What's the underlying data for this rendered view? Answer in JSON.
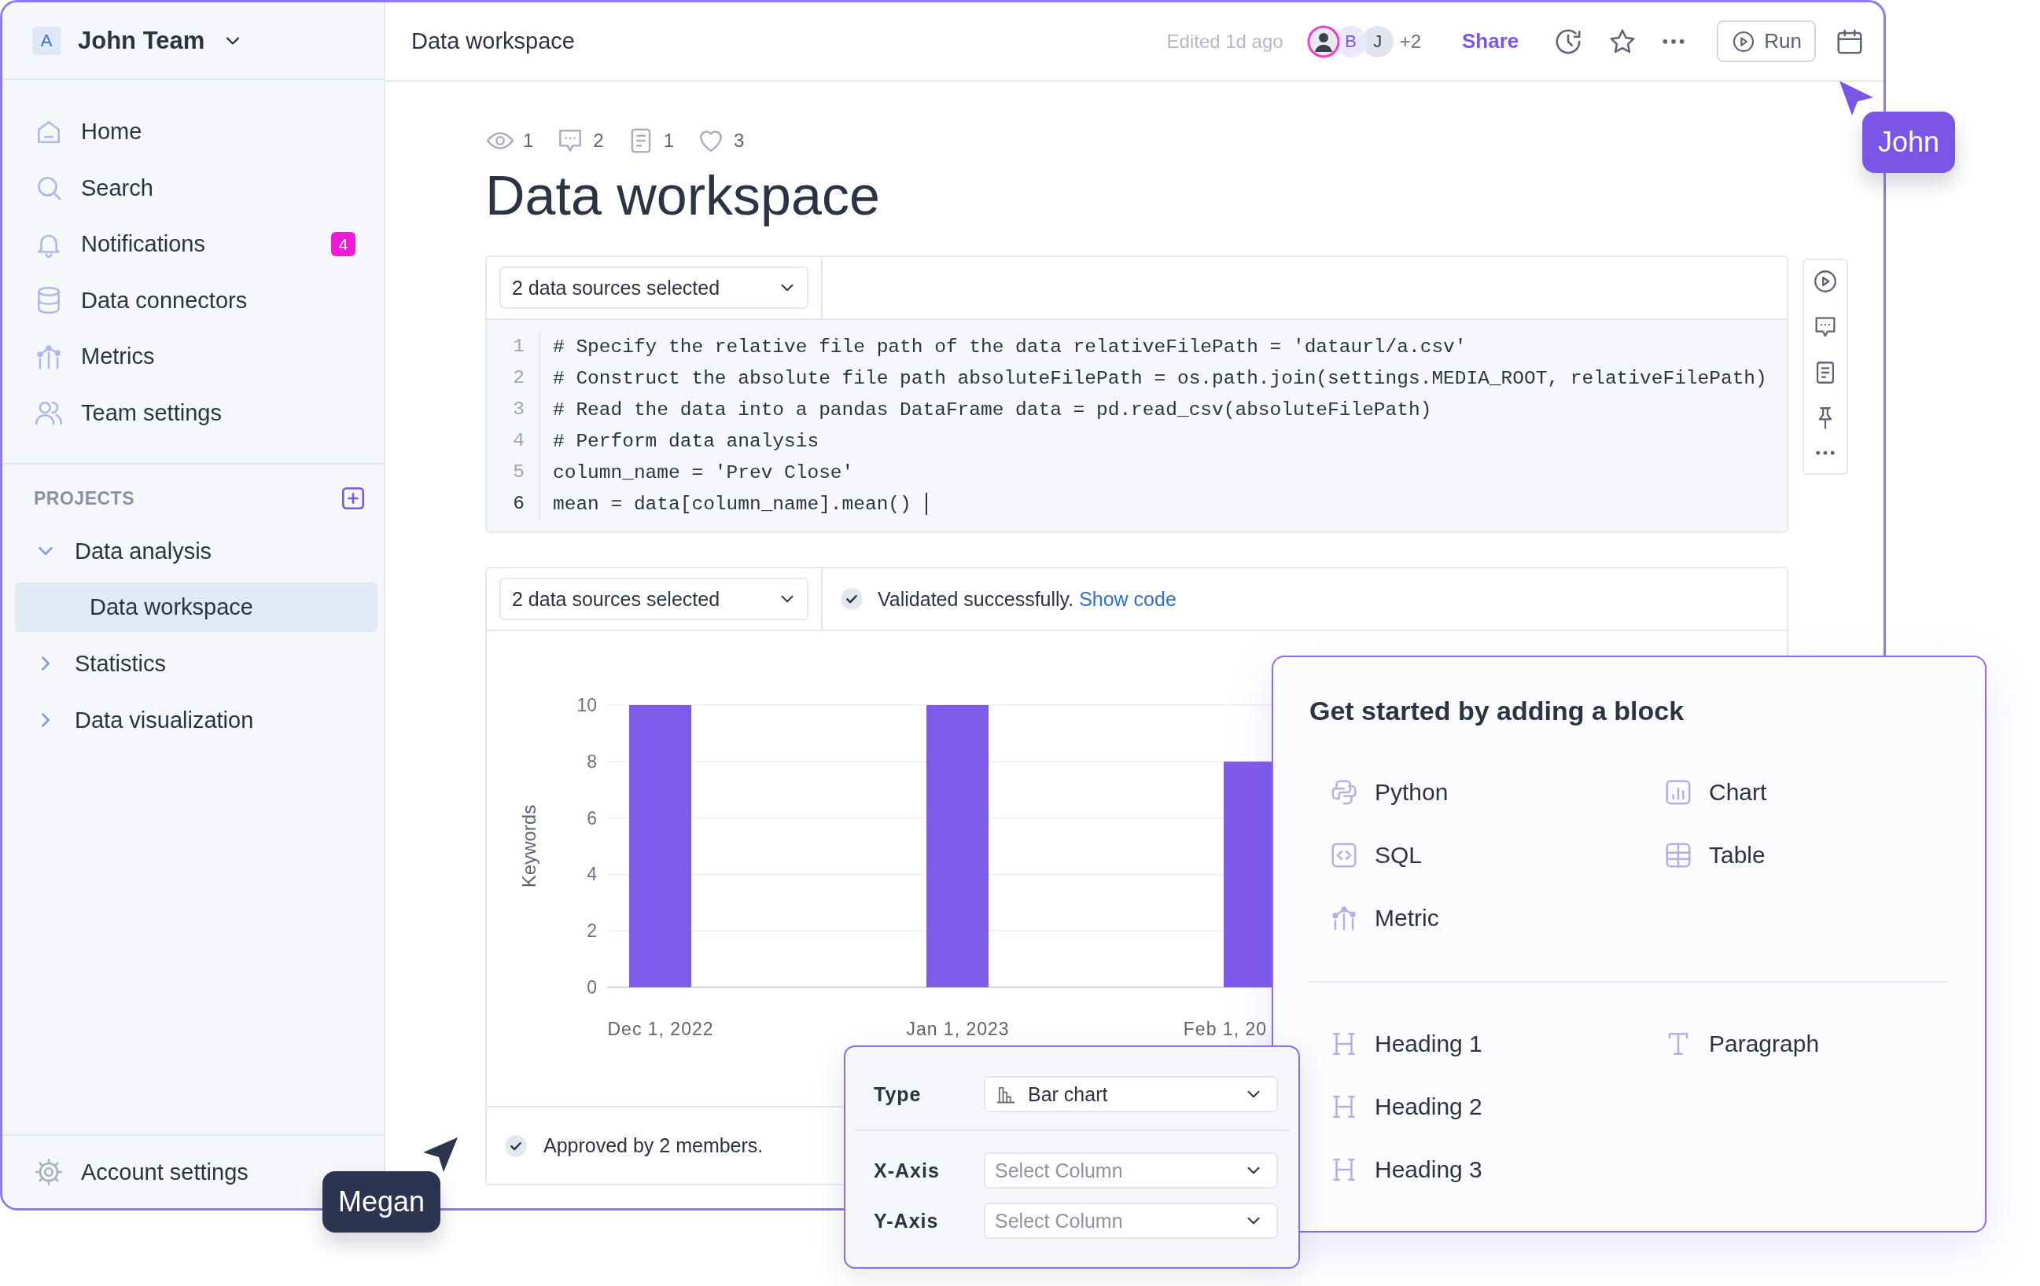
{
  "sidebar": {
    "team": {
      "initial": "A",
      "name": "John Team"
    },
    "nav": [
      {
        "label": "Home",
        "selected": false
      },
      {
        "label": "Search",
        "selected": false
      },
      {
        "label": "Notifications",
        "badge": "4",
        "selected": false
      },
      {
        "label": "Data connectors",
        "selected": false
      },
      {
        "label": "Metrics",
        "selected": false
      },
      {
        "label": "Team settings",
        "selected": false
      }
    ],
    "projects": {
      "title": "PROJECTS",
      "items": [
        {
          "label": "Data analysis",
          "expanded": true,
          "selected": false,
          "children": [
            {
              "label": "Data workspace",
              "selected": true
            }
          ]
        },
        {
          "label": "Statistics",
          "expanded": false,
          "selected": false
        },
        {
          "label": "Data visualization",
          "expanded": false,
          "selected": false
        }
      ]
    },
    "footer": "Account settings"
  },
  "topbar": {
    "title": "Data workspace",
    "edited": "Edited 1d ago",
    "avatars": [
      {
        "kind": "photo"
      },
      {
        "kind": "initial",
        "initial": "B"
      },
      {
        "kind": "initial",
        "initial": "J"
      }
    ],
    "more_count": "+2",
    "share": "Share",
    "run": "Run"
  },
  "document": {
    "stats": [
      {
        "count": "1"
      },
      {
        "count": "2"
      },
      {
        "count": "1"
      },
      {
        "count": "3"
      }
    ],
    "title": "Data workspace"
  },
  "code_block": {
    "source_select": "2 data sources selected",
    "lines": [
      {
        "number": "1",
        "code": "# Specify the relative file path of the data relativeFilePath = 'dataurl/a.csv'",
        "active": false
      },
      {
        "number": "2",
        "code": "# Construct the absolute file path absoluteFilePath = os.path.join(settings.MEDIA_ROOT, relativeFilePath)",
        "active": false
      },
      {
        "number": "3",
        "code": "# Read the data into a pandas DataFrame data = pd.read_csv(absoluteFilePath)",
        "active": false
      },
      {
        "number": "4",
        "code": "# Perform data analysis",
        "active": false
      },
      {
        "number": "5",
        "code": "column_name = 'Prev Close'",
        "active": false
      },
      {
        "number": "6",
        "code": "mean = data[column_name].mean()",
        "active": true
      }
    ]
  },
  "chart_block": {
    "source_select": "2 data sources selected",
    "status": {
      "validated": true,
      "text": "Validated successfully.",
      "link": "Show code"
    },
    "chart_data": {
      "type": "bar",
      "ylabel": "Keywords",
      "categories": [
        "Dec 1, 2022",
        "Jan 1, 2023",
        "Feb 1, 20"
      ],
      "values": [
        10,
        10,
        8
      ],
      "ylim": [
        0,
        10
      ],
      "yticks": [
        0,
        2,
        4,
        6,
        8,
        10
      ],
      "grid": true
    },
    "footer": {
      "approved": true,
      "text": "Approved by 2 members."
    }
  },
  "add_block_popup": {
    "title": "Get started by adding a block",
    "groups": [
      [
        {
          "kind": "python",
          "label": "Python"
        },
        {
          "kind": "sql",
          "label": "SQL"
        },
        {
          "kind": "metric",
          "label": "Metric"
        },
        {
          "kind": "chart",
          "label": "Chart"
        },
        {
          "kind": "table",
          "label": "Table"
        }
      ],
      [
        {
          "kind": "heading",
          "label": "Heading 1"
        },
        {
          "kind": "heading",
          "label": "Heading 2"
        },
        {
          "kind": "heading",
          "label": "Heading 3"
        },
        {
          "kind": "paragraph",
          "label": "Paragraph"
        }
      ]
    ]
  },
  "chart_config": {
    "fields": [
      {
        "label": "Type",
        "value": "Bar chart"
      },
      {
        "label": "X-Axis",
        "placeholder": "Select Column"
      },
      {
        "label": "Y-Axis",
        "placeholder": "Select Column"
      }
    ]
  },
  "cursors": [
    {
      "name": "John",
      "color": "#7b55e6"
    },
    {
      "name": "Megan",
      "color": "#2c3550"
    }
  ]
}
